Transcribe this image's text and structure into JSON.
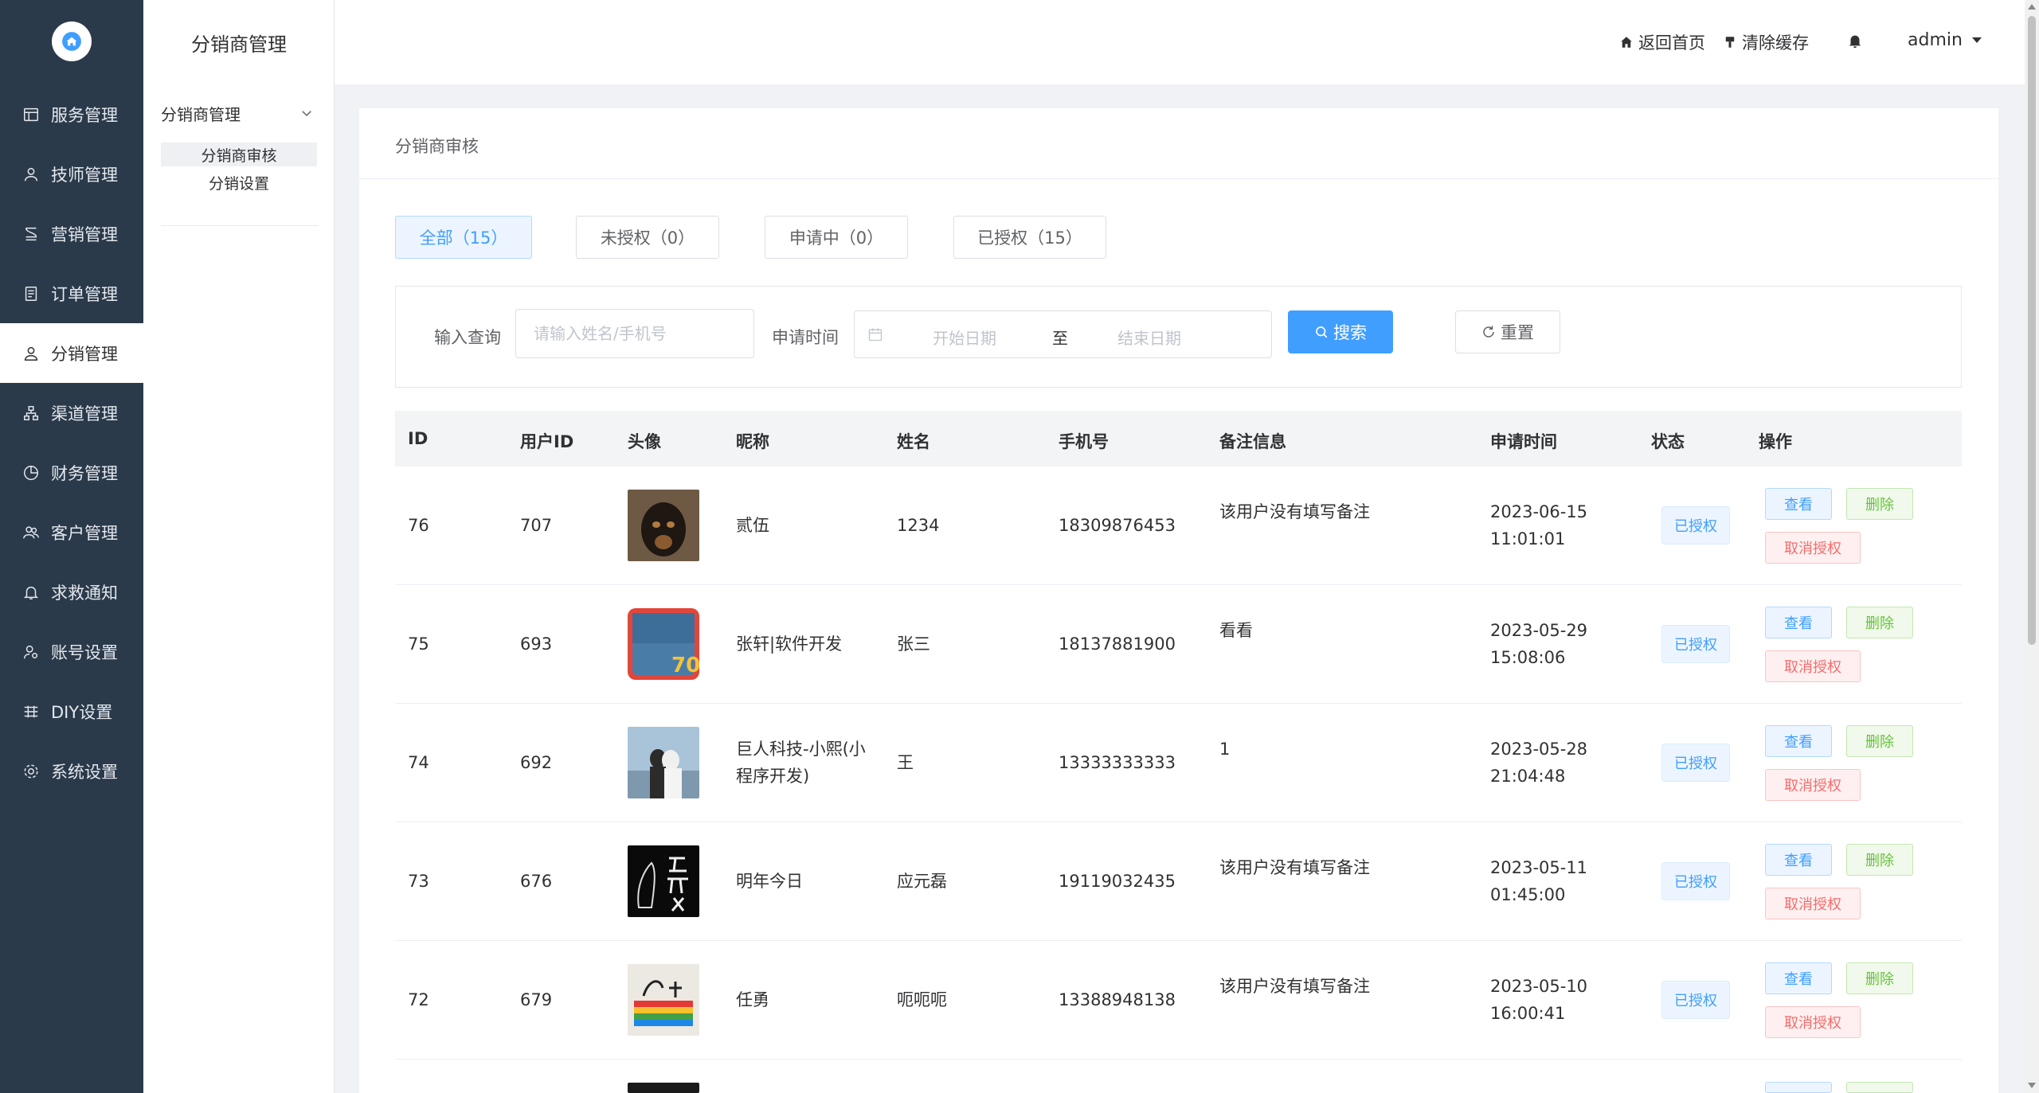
{
  "sidebar": {
    "items": [
      {
        "label": "服务管理",
        "icon": "service-icon"
      },
      {
        "label": "技师管理",
        "icon": "technician-icon"
      },
      {
        "label": "营销管理",
        "icon": "marketing-icon"
      },
      {
        "label": "订单管理",
        "icon": "order-icon"
      },
      {
        "label": "分销管理",
        "icon": "distribution-icon",
        "active": true
      },
      {
        "label": "渠道管理",
        "icon": "channel-icon"
      },
      {
        "label": "财务管理",
        "icon": "finance-icon"
      },
      {
        "label": "客户管理",
        "icon": "customer-icon"
      },
      {
        "label": "求救通知",
        "icon": "alert-bell-icon"
      },
      {
        "label": "账号设置",
        "icon": "account-icon"
      },
      {
        "label": "DIY设置",
        "icon": "diy-icon"
      },
      {
        "label": "系统设置",
        "icon": "settings-gear-icon"
      }
    ]
  },
  "subnav": {
    "title": "分销商管理",
    "group": "分销商管理",
    "items": [
      {
        "label": "分销商审核",
        "active": true
      },
      {
        "label": "分销设置"
      }
    ]
  },
  "header": {
    "home": "返回首页",
    "clear_cache": "清除缓存",
    "user": "admin"
  },
  "page": {
    "title": "分销商审核",
    "tabs": [
      {
        "label": "全部（15）",
        "active": true
      },
      {
        "label": "未授权（0）"
      },
      {
        "label": "申请中（0）"
      },
      {
        "label": "已授权（15）"
      }
    ],
    "search": {
      "query_label": "输入查询",
      "query_placeholder": "请输入姓名/手机号",
      "time_label": "申请时间",
      "start_placeholder": "开始日期",
      "separator": "至",
      "end_placeholder": "结束日期",
      "search_btn": "搜索",
      "reset_btn": "重置"
    }
  },
  "table": {
    "headers": [
      "ID",
      "用户ID",
      "头像",
      "昵称",
      "姓名",
      "手机号",
      "备注信息",
      "申请时间",
      "状态",
      "操作"
    ],
    "rows": [
      {
        "id": "76",
        "user_id": "707",
        "nickname": "贰伍",
        "name": "1234",
        "phone": "18309876453",
        "remark": "该用户没有填写备注",
        "date": "2023-06-15",
        "time": "11:01:01",
        "status": "已授权",
        "view": "查看",
        "delete": "删除",
        "revoke": "取消授权"
      },
      {
        "id": "75",
        "user_id": "693",
        "nickname": "张轩|软件开发",
        "name": "张三",
        "phone": "18137881900",
        "remark": "看看",
        "date": "2023-05-29",
        "time": "15:08:06",
        "status": "已授权",
        "view": "查看",
        "delete": "删除",
        "revoke": "取消授权"
      },
      {
        "id": "74",
        "user_id": "692",
        "nickname": "巨人科技-小熙(小程序开发)",
        "name": "王",
        "phone": "13333333333",
        "remark": "1",
        "date": "2023-05-28",
        "time": "21:04:48",
        "status": "已授权",
        "view": "查看",
        "delete": "删除",
        "revoke": "取消授权"
      },
      {
        "id": "73",
        "user_id": "676",
        "nickname": "明年今日",
        "name": "应元磊",
        "phone": "19119032435",
        "remark": "该用户没有填写备注",
        "date": "2023-05-11",
        "time": "01:45:00",
        "status": "已授权",
        "view": "查看",
        "delete": "删除",
        "revoke": "取消授权"
      },
      {
        "id": "72",
        "user_id": "679",
        "nickname": "任勇",
        "name": "呃呃呃",
        "phone": "13388948138",
        "remark": "该用户没有填写备注",
        "date": "2023-05-10",
        "time": "16:00:41",
        "status": "已授权",
        "view": "查看",
        "delete": "删除",
        "revoke": "取消授权"
      }
    ]
  },
  "colors": {
    "sidebar_bg": "#2b3a4a",
    "primary": "#409eff",
    "success": "#67c23a",
    "danger": "#f56c6c"
  }
}
